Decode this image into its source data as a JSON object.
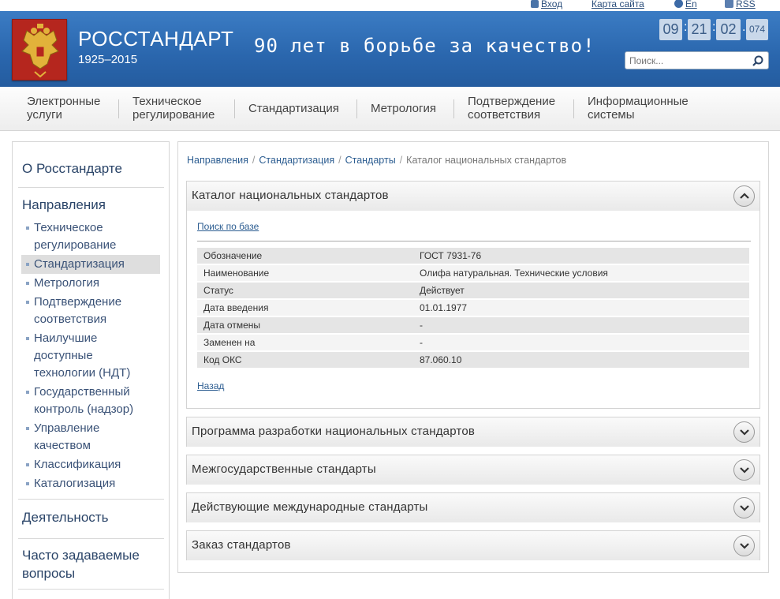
{
  "top_links": {
    "login": "Вход",
    "sitemap": "Карта сайта",
    "lang": "En",
    "rss": "RSS"
  },
  "header": {
    "brand": "РОССТАНДАРТ",
    "years": "1925–2015",
    "slogan": "90 лет в борьбе за качество!",
    "clock": {
      "h": "09",
      "m": "21",
      "s": "02",
      "ms": "074"
    },
    "search_placeholder": "Поиск..."
  },
  "nav": [
    {
      "line1": "Электронные",
      "line2": "услуги"
    },
    {
      "line1": "Техническое",
      "line2": "регулирование"
    },
    {
      "line1": "Стандартизация",
      "line2": ""
    },
    {
      "line1": "Метрология",
      "line2": ""
    },
    {
      "line1": "Подтверждение",
      "line2": "соответствия"
    },
    {
      "line1": "Информационные",
      "line2": "системы"
    }
  ],
  "sidebar": {
    "about": "О Росстандарте",
    "directions": "Направления",
    "items": [
      {
        "l1": "Техническое",
        "l2": "регулирование"
      },
      {
        "l1": "Стандартизация",
        "l2": ""
      },
      {
        "l1": "Метрология",
        "l2": ""
      },
      {
        "l1": "Подтверждение",
        "l2": "соответствия"
      },
      {
        "l1": "Наилучшие",
        "l2": "доступные",
        "l3": "технологии (НДТ)"
      },
      {
        "l1": "Государственный",
        "l2": "контроль (надзор)"
      },
      {
        "l1": "Управление",
        "l2": "качеством"
      },
      {
        "l1": "Классификация",
        "l2": ""
      },
      {
        "l1": "Каталогизация",
        "l2": ""
      }
    ],
    "activity": "Деятельность",
    "faq_l1": "Часто задаваемые",
    "faq_l2": "вопросы"
  },
  "breadcrumbs": [
    "Направления",
    "Стандартизация",
    "Стандарты",
    "Каталог национальных стандартов"
  ],
  "catalog": {
    "title": "Каталог национальных стандартов",
    "search_link": "Поиск по базе",
    "rows": [
      [
        "Обозначение",
        "ГОСТ 7931-76"
      ],
      [
        "Наименование",
        "Олифа натуральная. Технические условия"
      ],
      [
        "Статус",
        "Действует"
      ],
      [
        "Дата введения",
        "01.01.1977"
      ],
      [
        "Дата отмены",
        "-"
      ],
      [
        "Заменен на",
        "-"
      ],
      [
        "Код ОКС",
        "87.060.10"
      ]
    ],
    "back_link": "Назад"
  },
  "panels": [
    "Программа разработки национальных стандартов",
    "Межгосударственные стандарты",
    "Действующие международные стандарты",
    "Заказ стандартов"
  ]
}
